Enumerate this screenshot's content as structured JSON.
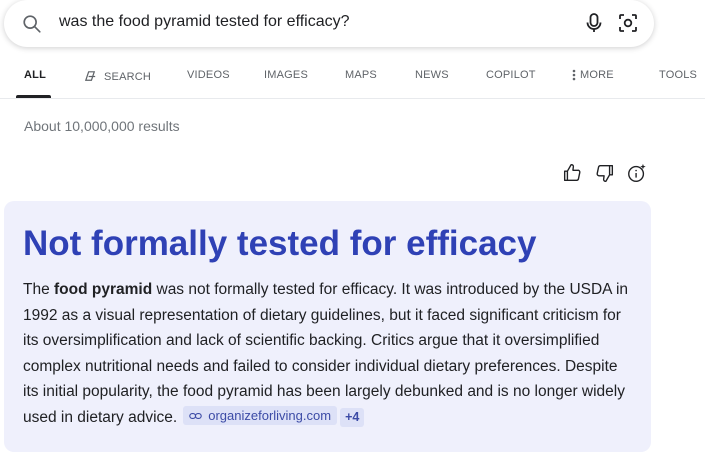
{
  "search": {
    "query": "was the food pyramid tested for efficacy?"
  },
  "tabs": [
    {
      "label": "ALL"
    },
    {
      "label": "SEARCH"
    },
    {
      "label": "VIDEOS"
    },
    {
      "label": "IMAGES"
    },
    {
      "label": "MAPS"
    },
    {
      "label": "NEWS"
    },
    {
      "label": "COPILOT"
    },
    {
      "label": "MORE"
    },
    {
      "label": "TOOLS"
    }
  ],
  "results_count": "About 10,000,000 results",
  "answer": {
    "heading": "Not formally tested for efficacy",
    "intro": "The ",
    "bold_term": "food pyramid",
    "text": " was not formally tested for efficacy. It was introduced by the USDA in 1992 as a visual representation of dietary guidelines, but it faced significant criticism for its oversimplification and lack of scientific backing. Critics argue that it oversimplified complex nutritional needs and failed to consider individual dietary preferences. Despite its initial popularity, the food pyramid has been largely debunked and is no longer widely used in dietary advice.",
    "source": "organizeforliving.com",
    "more_sources": "+4"
  },
  "colors": {
    "heading": "#2f41b5",
    "card_bg": "#eff0fc",
    "chip_bg": "#dde1f7"
  }
}
